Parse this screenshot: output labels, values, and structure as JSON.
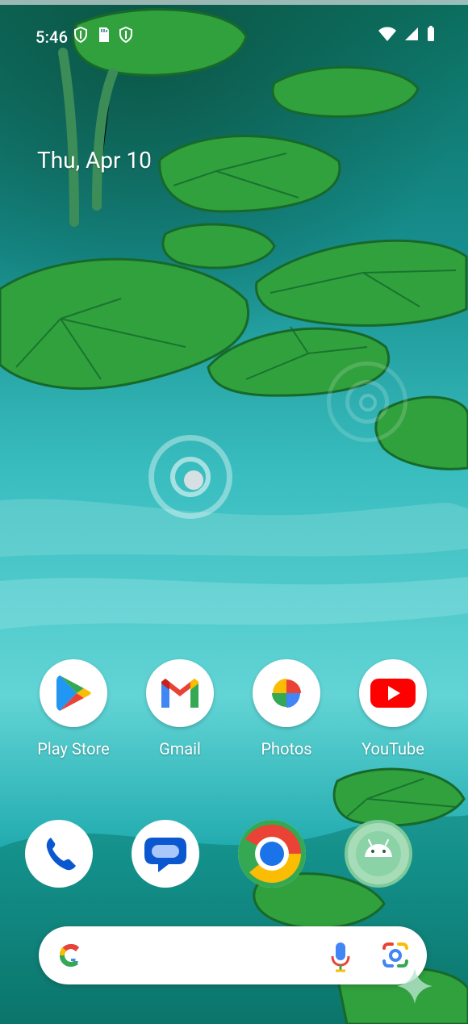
{
  "status": {
    "time": "5:46"
  },
  "home": {
    "date": "Thu, Apr 10"
  },
  "apps": {
    "row1": [
      {
        "label": "Play Store",
        "icon": "play-store-icon"
      },
      {
        "label": "Gmail",
        "icon": "gmail-icon"
      },
      {
        "label": "Photos",
        "icon": "photos-icon"
      },
      {
        "label": "YouTube",
        "icon": "youtube-icon"
      }
    ],
    "dock": [
      {
        "icon": "phone-icon"
      },
      {
        "icon": "messages-icon"
      },
      {
        "icon": "chrome-icon"
      },
      {
        "icon": "android-icon"
      }
    ]
  },
  "search": {
    "google_icon": "google-g-icon",
    "voice_icon": "microphone-icon",
    "lens_icon": "lens-icon"
  },
  "colors": {
    "water": "#1fb5b4",
    "lily": "#35a843",
    "white": "#ffffff"
  }
}
